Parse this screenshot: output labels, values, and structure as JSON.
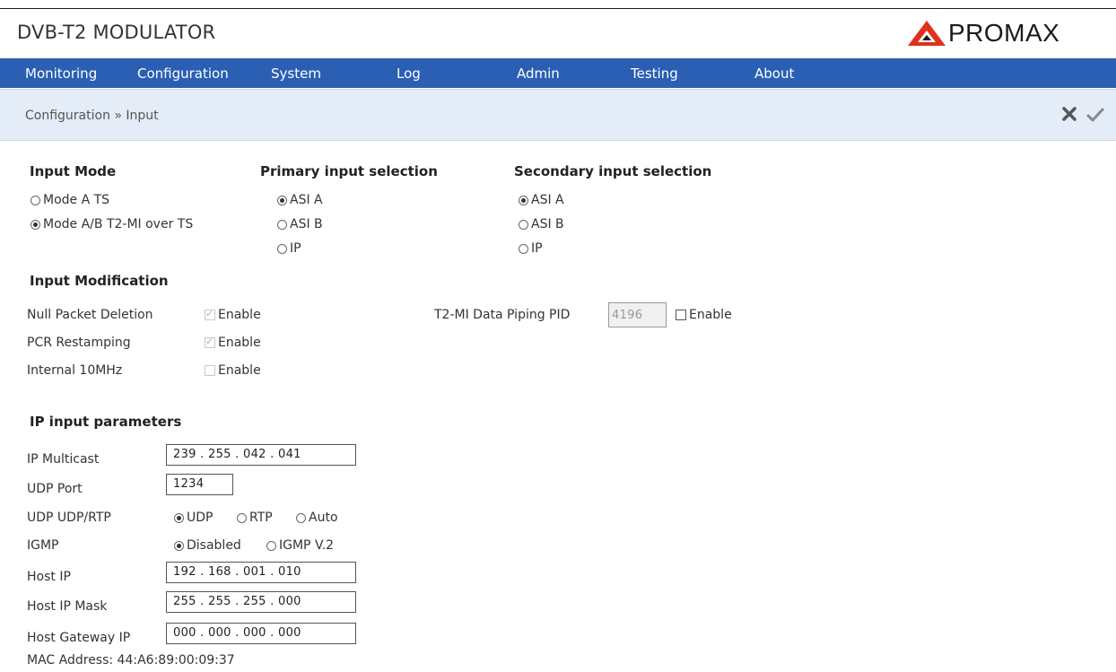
{
  "app": {
    "title": "DVB-T2 MODULATOR",
    "logo_text": "PROMAX"
  },
  "nav": {
    "items": [
      "Monitoring",
      "Configuration",
      "System",
      "Log",
      "Admin",
      "Testing",
      "About"
    ]
  },
  "breadcrumb": "Configuration » Input",
  "toolbar": {
    "cancel_icon": "x-icon",
    "confirm_icon": "check-icon"
  },
  "input_mode": {
    "title": "Input Mode",
    "options": [
      {
        "label": "Mode A TS",
        "selected": false
      },
      {
        "label": "Mode A/B T2-MI over TS",
        "selected": true
      }
    ]
  },
  "primary_input": {
    "title": "Primary input selection",
    "options": [
      {
        "label": "ASI A",
        "selected": true
      },
      {
        "label": "ASI B",
        "selected": false
      },
      {
        "label": "IP",
        "selected": false
      }
    ]
  },
  "secondary_input": {
    "title": "Secondary input selection",
    "options": [
      {
        "label": "ASI A",
        "selected": true
      },
      {
        "label": "ASI B",
        "selected": false
      },
      {
        "label": "IP",
        "selected": false
      }
    ]
  },
  "input_modification": {
    "title": "Input Modification",
    "rows": [
      {
        "label": "Null Packet Deletion",
        "check_label": "Enable",
        "checked": true,
        "disabled": true
      },
      {
        "label": "PCR Restamping",
        "check_label": "Enable",
        "checked": true,
        "disabled": true
      },
      {
        "label": "Internal 10MHz",
        "check_label": "Enable",
        "checked": false,
        "disabled": true
      }
    ],
    "t2mi_pid": {
      "label": "T2-MI Data Piping PID",
      "value": "4196",
      "check_label": "Enable",
      "checked": false
    }
  },
  "ip_params": {
    "title": "IP input parameters",
    "ip_multicast": {
      "label": "IP Multicast",
      "value": "239 . 255 . 042 . 041"
    },
    "udp_port": {
      "label": "UDP Port",
      "value": "1234"
    },
    "udp_rtp": {
      "label": "UDP UDP/RTP",
      "options": [
        {
          "label": "UDP",
          "selected": true
        },
        {
          "label": "RTP",
          "selected": false
        },
        {
          "label": "Auto",
          "selected": false
        }
      ]
    },
    "igmp": {
      "label": "IGMP",
      "options": [
        {
          "label": "Disabled",
          "selected": true
        },
        {
          "label": "IGMP V.2",
          "selected": false
        }
      ]
    },
    "host_ip": {
      "label": "Host IP",
      "value": "192 . 168 . 001 . 010"
    },
    "host_mask": {
      "label": "Host IP Mask",
      "value": "255 . 255 . 255 . 000"
    },
    "gateway": {
      "label": "Host Gateway IP",
      "value": "000 . 000 . 000 . 000"
    },
    "mac": "MAC Address: 44:A6:89:00:09:37"
  },
  "colors": {
    "nav_bg": "#2a5fb4",
    "crumb_bg": "#e3ecf7",
    "logo_red": "#e0301e"
  }
}
